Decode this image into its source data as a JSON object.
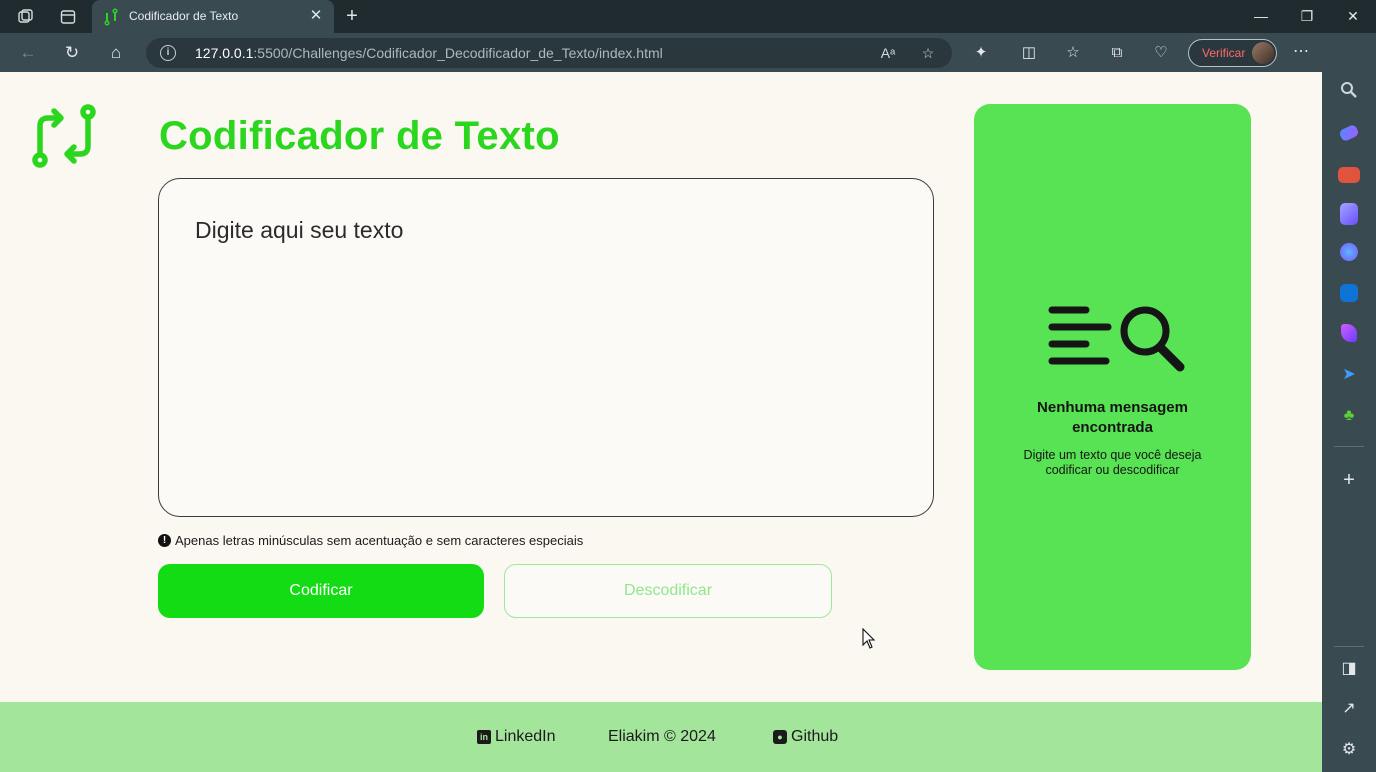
{
  "browser": {
    "tab": {
      "title": "Codificador de Texto"
    },
    "url": {
      "host": "127.0.0.1",
      "rest": ":5500/Challenges/Codificador_Decodificador_de_Texto/index.html"
    },
    "profile_button": {
      "label": "Verificar"
    },
    "icons": [
      "workspaces-icon",
      "tab-actions-icon",
      "back-icon",
      "refresh-icon",
      "home-icon",
      "read-aloud-icon",
      "favorite-star-icon",
      "extensions-icon",
      "split-screen-icon",
      "favorites-icon",
      "collections-icon",
      "browser-essentials-icon",
      "more-icon",
      "copilot-icon"
    ],
    "accent": "#ff6a6a"
  },
  "sidebar": {
    "items": [
      "search-icon",
      "shopping-icon",
      "tools-icon",
      "games-icon",
      "microsoft365-icon",
      "outlook-icon",
      "designer-icon",
      "send-icon",
      "tree-icon",
      "add-icon",
      "split-pane-icon",
      "external-icon",
      "settings-icon"
    ]
  },
  "app": {
    "title": "Codificador de Texto",
    "textarea": {
      "placeholder": "Digite aqui seu texto"
    },
    "hint": "Apenas letras minúsculas sem acentuação e sem caracteres especiais",
    "buttons": {
      "encode": "Codificar",
      "decode": "Descodificar"
    },
    "result": {
      "title": "Nenhuma mensagem encontrada",
      "description": "Digite um texto que você deseja codificar ou descodificar"
    },
    "footer": {
      "linkedin": "LinkedIn",
      "copyright": "Eliakim © 2024",
      "github": "Github"
    },
    "colors": {
      "brand_green": "#2bd61f",
      "button_green": "#14dc14",
      "panel_green": "#57e353",
      "footer_green": "#a4e59c",
      "background": "#fbf7f1"
    }
  }
}
